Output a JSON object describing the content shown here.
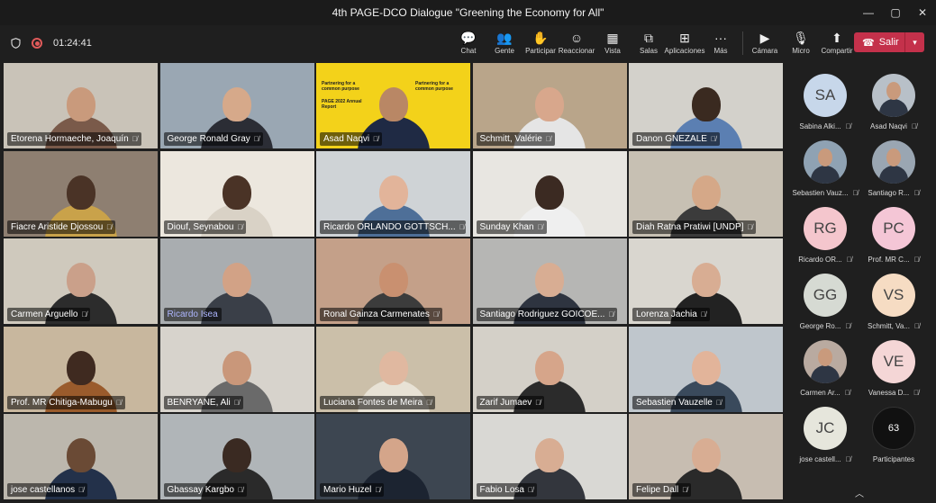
{
  "window": {
    "title": "4th PAGE-DCO Dialogue \"Greening the Economy for All\"",
    "controls": [
      "—",
      "▢",
      "✕"
    ]
  },
  "toolbar": {
    "timer": "01:24:41",
    "items": [
      {
        "label": "Chat",
        "icon": "chat-icon",
        "glyph": "💬"
      },
      {
        "label": "Gente",
        "icon": "people-icon",
        "glyph": "👥"
      },
      {
        "label": "Participar",
        "icon": "raise-hand-icon",
        "glyph": "✋"
      },
      {
        "label": "Reaccionar",
        "icon": "react-icon",
        "glyph": "☺"
      },
      {
        "label": "Vista",
        "icon": "grid-view-icon",
        "glyph": "▦"
      },
      {
        "label": "Salas",
        "icon": "rooms-icon",
        "glyph": "⧉"
      },
      {
        "label": "Aplicaciones",
        "icon": "apps-icon",
        "glyph": "⊞"
      },
      {
        "label": "Más",
        "icon": "more-icon",
        "glyph": "···"
      }
    ],
    "devices": [
      {
        "label": "Cámara",
        "icon": "camera-icon",
        "glyph": "▶"
      },
      {
        "label": "Micro",
        "icon": "mic-icon",
        "glyph": "🎙"
      },
      {
        "label": "Compartir",
        "icon": "share-icon",
        "glyph": "⬆"
      }
    ],
    "leave_label": "Salir"
  },
  "tiles": [
    {
      "name": "Etorena Hormaeche, Joaquín",
      "bg": "#c9c3b8",
      "skin": "#c99a7c",
      "shirt": "#7a5a4a"
    },
    {
      "name": "George Ronald Gray",
      "bg": "#9aa7b3",
      "skin": "#d6a98a",
      "shirt": "#2b2d35"
    },
    {
      "name": "Asad Naqvi",
      "bg": "#f3d21a",
      "skin": "#b98765",
      "shirt": "#1f2a44",
      "poster": true
    },
    {
      "name": "Schmitt, Valérie",
      "bg": "#b9a58a",
      "skin": "#d8a78c",
      "shirt": "#e5e5e5"
    },
    {
      "name": "Danon GNEZALE",
      "bg": "#d3d1cb",
      "skin": "#3a2a20",
      "shirt": "#5b7fb2"
    },
    {
      "name": "Fiacre Aristide Djossou",
      "bg": "#8e7f71",
      "skin": "#4a3326",
      "shirt": "#c9a24a"
    },
    {
      "name": "Diouf, Seynabou",
      "bg": "#ece7de",
      "skin": "#4a3326",
      "shirt": "#d9d2c6"
    },
    {
      "name": "Ricardo ORLANDO GOTTSCH...",
      "bg": "#cfd3d6",
      "skin": "#e2b49a",
      "shirt": "#4e6f98"
    },
    {
      "name": "Sunday Khan",
      "bg": "#e8e6e1",
      "skin": "#3b2a22",
      "shirt": "#efefef"
    },
    {
      "name": "Diah Ratna Pratiwi [UNDP]",
      "bg": "#c7c0b3",
      "skin": "#d5a888",
      "shirt": "#3b3b3b"
    },
    {
      "name": "Carmen Arguello",
      "bg": "#cfc9bd",
      "skin": "#caa08a",
      "shirt": "#2c2c2c"
    },
    {
      "name": "Ricardo Isea",
      "bg": "#a9adb0",
      "skin": "#d2a286",
      "shirt": "#3a3f48",
      "highlight": true
    },
    {
      "name": "Ronal Gainza Carmenates",
      "bg": "#c4a089",
      "skin": "#c99070",
      "shirt": "#3c3c3c"
    },
    {
      "name": "Santiago Rodriguez GOICOE...",
      "bg": "#b6b6b4",
      "skin": "#d8ad93",
      "shirt": "#2e3440"
    },
    {
      "name": "Lorenza Jachia",
      "bg": "#d9d6cf",
      "skin": "#d8ad93",
      "shirt": "#222"
    },
    {
      "name": "Prof. MR Chitiga-Mabugu",
      "bg": "#c8b79e",
      "skin": "#3f2a20",
      "shirt": "#9a5b2c"
    },
    {
      "name": "BENRYANE, Ali",
      "bg": "#d7d3cc",
      "skin": "#c9977a",
      "shirt": "#6a6a6a"
    },
    {
      "name": "Luciana Fontes de Meira",
      "bg": "#cbbfa9",
      "skin": "#e0b8a0",
      "shirt": "#e8e2d5"
    },
    {
      "name": "Zarif Jumaev",
      "bg": "#d4d0c8",
      "skin": "#d6a58a",
      "shirt": "#2b2b2b"
    },
    {
      "name": "Sebastien Vauzelle",
      "bg": "#bfc6cc",
      "skin": "#e2b49a",
      "shirt": "#3a4a5c"
    },
    {
      "name": "jose castellanos",
      "bg": "#bcb7ad",
      "skin": "#6a4a35",
      "shirt": "#23314a"
    },
    {
      "name": "Gbassay Kargbo",
      "bg": "#b0b5b8",
      "skin": "#3a2a22",
      "shirt": "#2a2a2a"
    },
    {
      "name": "Mario Huzel",
      "bg": "#3d4651",
      "skin": "#d4a58a",
      "shirt": "#1c2431"
    },
    {
      "name": "Fabio Losa",
      "bg": "#d9d8d4",
      "skin": "#d8ad93",
      "shirt": "#33363d"
    },
    {
      "name": "Felipe Dall",
      "bg": "#c7bdb1",
      "skin": "#d8ad93",
      "shirt": "#2a2a2a"
    }
  ],
  "poster": {
    "lines": [
      "Partnering for a common purpose",
      "PAGE 2022 Annual Report",
      "Partnering for a common purpose"
    ]
  },
  "participants": [
    {
      "initials": "SA",
      "name": "Sabina Alki...",
      "color": "#c7d7ea",
      "photo": false
    },
    {
      "initials": "",
      "name": "Asad Naqvi",
      "color": "#b8c0c8",
      "photo": true
    },
    {
      "initials": "",
      "name": "Sebastien Vauz...",
      "color": "#8fa2b3",
      "photo": true
    },
    {
      "initials": "",
      "name": "Santiago R...",
      "color": "#9aa6b2",
      "photo": true
    },
    {
      "initials": "RG",
      "name": "Ricardo OR...",
      "color": "#f4c6cd",
      "photo": false
    },
    {
      "initials": "PC",
      "name": "Prof. MR C...",
      "color": "#f4c6d6",
      "photo": false
    },
    {
      "initials": "GG",
      "name": "George Ro...",
      "color": "#d6dad3",
      "photo": false
    },
    {
      "initials": "VS",
      "name": "Schmitt, Va...",
      "color": "#f6dcc3",
      "photo": false
    },
    {
      "initials": "",
      "name": "Carmen Ar...",
      "color": "#b9aaa0",
      "photo": true
    },
    {
      "initials": "VE",
      "name": "Vanessa D...",
      "color": "#f4d6d6",
      "photo": false
    },
    {
      "initials": "JC",
      "name": "jose castell...",
      "color": "#e6e6dc",
      "photo": false
    },
    {
      "initials": "63",
      "name": "Participantes",
      "color": "#111111",
      "photo": false,
      "count": true
    }
  ],
  "icons": {
    "shield": "shield-icon",
    "record": "record-icon",
    "mic_off": "mic-off-icon",
    "chevron_up": "chevron-up-icon"
  }
}
